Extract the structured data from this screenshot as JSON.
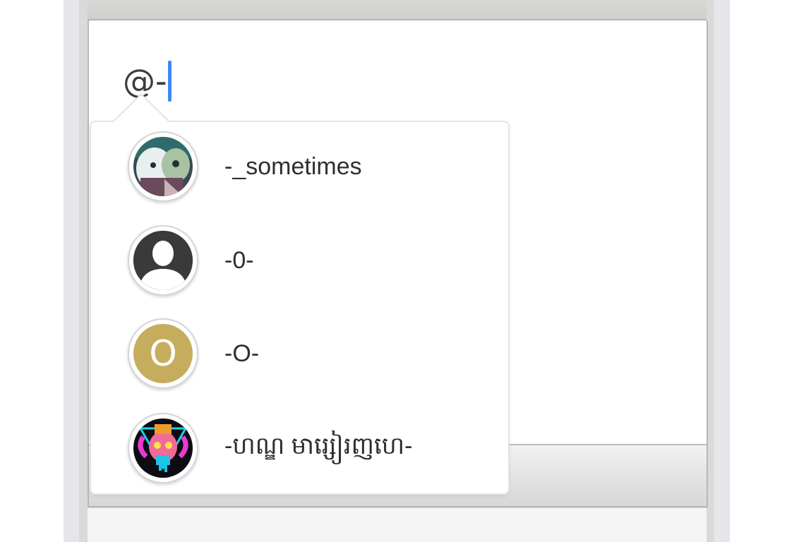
{
  "editor": {
    "typed_text": "@-"
  },
  "mention_suggestions": [
    {
      "username": "-_sometimes",
      "avatar": "anime-character-photo"
    },
    {
      "username": "-0-",
      "avatar": "default-person-silhouette-icon"
    },
    {
      "username": "-O-",
      "avatar_letter": "O",
      "avatar_color": "#c6ad5e"
    },
    {
      "username": "-ហណ្ឌ មារ្សៀរញហេ-",
      "avatar": "colorful-mask-art"
    }
  ],
  "colors": {
    "caret": "#3d8af7",
    "letter_avatar": "#c6ad5e"
  }
}
